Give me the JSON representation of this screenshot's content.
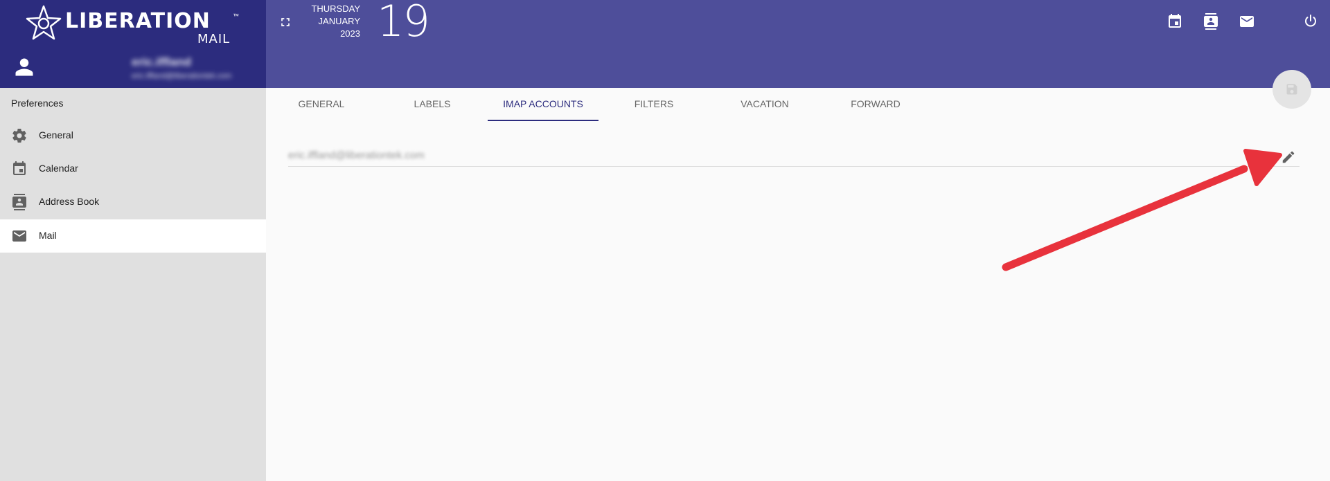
{
  "app": {
    "logo_text": "LIBERATION",
    "logo_sub": "MAIL",
    "logo_tm": "™"
  },
  "user": {
    "name": "eric.iffland",
    "email": "eric.iffland@liberationtek.com"
  },
  "date": {
    "weekday": "THURSDAY",
    "month": "JANUARY",
    "year": "2023",
    "day": "19"
  },
  "sidebar": {
    "title": "Preferences",
    "items": [
      {
        "label": "General",
        "icon": "gear-icon"
      },
      {
        "label": "Calendar",
        "icon": "calendar-icon"
      },
      {
        "label": "Address Book",
        "icon": "contact-card-icon"
      },
      {
        "label": "Mail",
        "icon": "mail-icon",
        "active": true
      }
    ]
  },
  "tabs": [
    {
      "label": "GENERAL"
    },
    {
      "label": "LABELS"
    },
    {
      "label": "IMAP ACCOUNTS",
      "active": true
    },
    {
      "label": "FILTERS"
    },
    {
      "label": "VACATION"
    },
    {
      "label": "FORWARD"
    }
  ],
  "imap": {
    "account_email": "eric.iffland@liberationtek.com"
  },
  "colors": {
    "header": "#4e4e9a",
    "brand": "#2c2c7e",
    "accent": "#2c2c7e",
    "annotation_arrow": "#e8323c"
  }
}
